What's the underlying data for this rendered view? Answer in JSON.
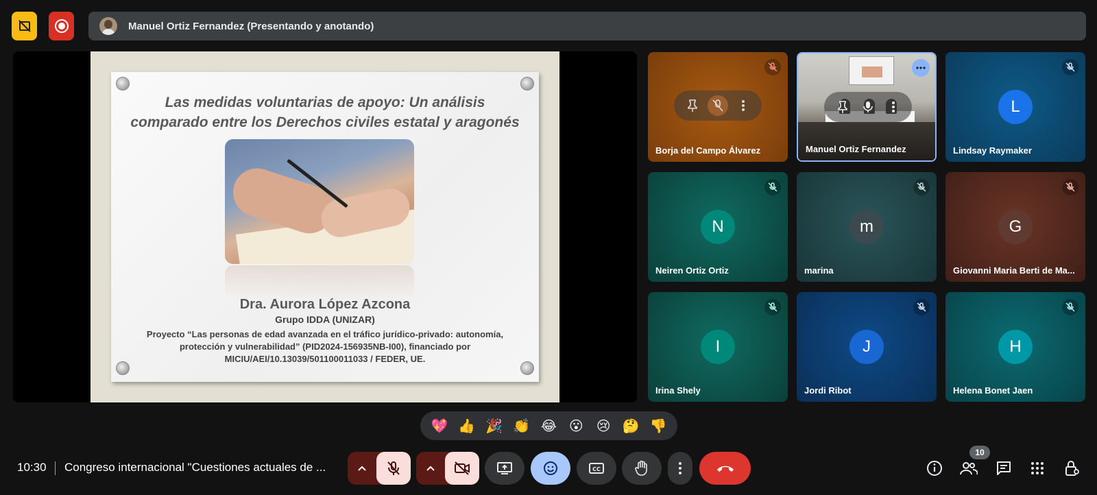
{
  "presenter_bar": {
    "text": "Manuel Ortiz Fernandez (Presentando y anotando)"
  },
  "slide": {
    "title_line1": "Las medidas voluntarias de apoyo: Un análisis",
    "title_line2": "comparado entre los Derechos civiles estatal y aragonés",
    "author": "Dra. Aurora López Azcona",
    "group": "Grupo IDDA (UNIZAR)",
    "project_line1": "Proyecto “Las personas de edad avanzada en el tráfico jurídico-privado: autonomía,",
    "project_line2": "protección y vulnerabilidad” (PID2024-156935NB-I00), financiado por",
    "project_line3": "MICIU/AEI/10.13039/501100011033 / FEDER, UE."
  },
  "participants": [
    {
      "name": "Borja del Campo Álvarez",
      "initial": "",
      "color": "#b35a12"
    },
    {
      "name": "Manuel Ortiz Fernandez",
      "initial": "",
      "color": "#888"
    },
    {
      "name": "Lindsay Raymaker",
      "initial": "L",
      "color": "#1a73e8"
    },
    {
      "name": "Neiren Ortiz Ortiz",
      "initial": "N",
      "color": "#00897b"
    },
    {
      "name": "marina",
      "initial": "m",
      "color": "#3c4a50"
    },
    {
      "name": "Giovanni Maria Berti de Ma...",
      "initial": "G",
      "color": "#5e3a30"
    },
    {
      "name": "Irina Shely",
      "initial": "I",
      "color": "#00897b"
    },
    {
      "name": "Jordi Ribot",
      "initial": "J",
      "color": "#1967d2"
    },
    {
      "name": "Helena Bonet Jaen",
      "initial": "H",
      "color": "#0097a7"
    }
  ],
  "reactions": [
    "💖",
    "👍",
    "🎉",
    "👏",
    "😂",
    "😮",
    "😢",
    "🤔",
    "👎"
  ],
  "bottom": {
    "time": "10:30",
    "meeting_title": "Congreso internacional \"Cuestiones actuales de ...",
    "people_count": "10"
  },
  "colors": {
    "accent": "#8ab4f8",
    "hangup": "#dc362e",
    "mic_off_bg": "#f9dedc"
  }
}
